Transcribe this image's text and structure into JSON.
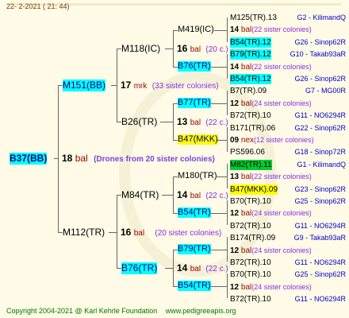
{
  "header": {
    "date": "22-  2-2021 ( 21: 44)"
  },
  "footer": {
    "copyright": "Copyright 2004-2021 @ Karl Kehrle Foundation",
    "url": "www.pedigreeapis.org"
  },
  "root": {
    "label": "B37(BB)"
  },
  "gen1": {
    "num": "18",
    "tag": "bal",
    "note": "(Drones from 20 sister colonies)"
  },
  "nodes": {
    "m151": "M151(BB)",
    "m112": "M112(TR)",
    "m118": "M118(IC)",
    "b26": "B26(TR)",
    "m84": "M84(TR)",
    "b76": "B76(TR)",
    "m419": "M419(IC)",
    "b76a": "B76(TR)",
    "b77": "B77(TR)",
    "b47": "B47(MKK)",
    "m180": "M180(TR)",
    "b54": "B54(TR)",
    "b79": "B79(TR)",
    "b54b": "B54(TR)"
  },
  "mids": {
    "m151": {
      "num": "17",
      "tag": "mrk",
      "note": "(33 sister colonies)"
    },
    "m112": {
      "num": "16",
      "tag": "bal",
      "note": "(20 sister colonies)"
    },
    "m118": {
      "num": "16",
      "tag": "bal",
      "note": "(20 c.)"
    },
    "b26": {
      "num": "13",
      "tag": "bal",
      "note": "(22 c.)"
    },
    "m84": {
      "num": "14",
      "tag": "bal",
      "note": "(22 c.)"
    },
    "b76": {
      "num": "14",
      "tag": "bal",
      "note": "(22 c.)"
    }
  },
  "leaves": [
    {
      "label": "M125(TR).13",
      "right": "G2 - KilimandQ",
      "hl": ""
    },
    {
      "num": "14",
      "tag": "bal",
      "note": "(22 sister colonies)"
    },
    {
      "label": "B54(TR).12",
      "right": "G26 - Sinop62R",
      "hl": "cyan"
    },
    {
      "label": "B79(TR).12",
      "right": "G10 - Takab93aR",
      "hl": "cyan"
    },
    {
      "num": "14",
      "tag": "bal",
      "note": "(22 sister colonies)"
    },
    {
      "label": "B54(TR).12",
      "right": "G26 - Sinop62R",
      "hl": "cyan"
    },
    {
      "label": "B7(TR).09",
      "right": "G7 - MG00R",
      "hl": ""
    },
    {
      "num": "12",
      "tag": "bal",
      "note": "(24 sister colonies)"
    },
    {
      "label": "B72(TR).10",
      "right": "G11 - NO6294R",
      "hl": ""
    },
    {
      "label": "B171(TR).06",
      "right": "G22 - Sinop62R",
      "hl": ""
    },
    {
      "num": "09",
      "tag": "nex",
      "note": "(12 sister colonies)"
    },
    {
      "label": "PS596.06",
      "right": "G18 - Sinop72R",
      "hl": ""
    },
    {
      "label": "M82(TR).11",
      "right": "G1 - KilimandQ",
      "hl": "green"
    },
    {
      "num": "13",
      "tag": "bal",
      "note": "(22 sister colonies)"
    },
    {
      "label": "B47(MKK).09",
      "right": "G23 - Sinop62R",
      "hl": "yellow"
    },
    {
      "label": "B70(TR).10",
      "right": "G25 - Sinop62R",
      "hl": ""
    },
    {
      "num": "12",
      "tag": "bal",
      "note": "(24 sister colonies)"
    },
    {
      "label": "B72(TR).10",
      "right": "G11 - NO6294R",
      "hl": ""
    },
    {
      "label": "B174(TR).09",
      "right": "G9 - Takab93aR",
      "hl": ""
    },
    {
      "num": "12",
      "tag": "bal",
      "note": "(24 sister colonies)"
    },
    {
      "label": "B72(TR).10",
      "right": "G11 - NO6294R",
      "hl": ""
    },
    {
      "label": "B70(TR).10",
      "right": "G25 - Sinop62R",
      "hl": ""
    },
    {
      "num": "12",
      "tag": "bal",
      "note": "(24 sister colonies)"
    },
    {
      "label": "B72(TR).10",
      "right": "G11 - NO6294R",
      "hl": ""
    }
  ]
}
